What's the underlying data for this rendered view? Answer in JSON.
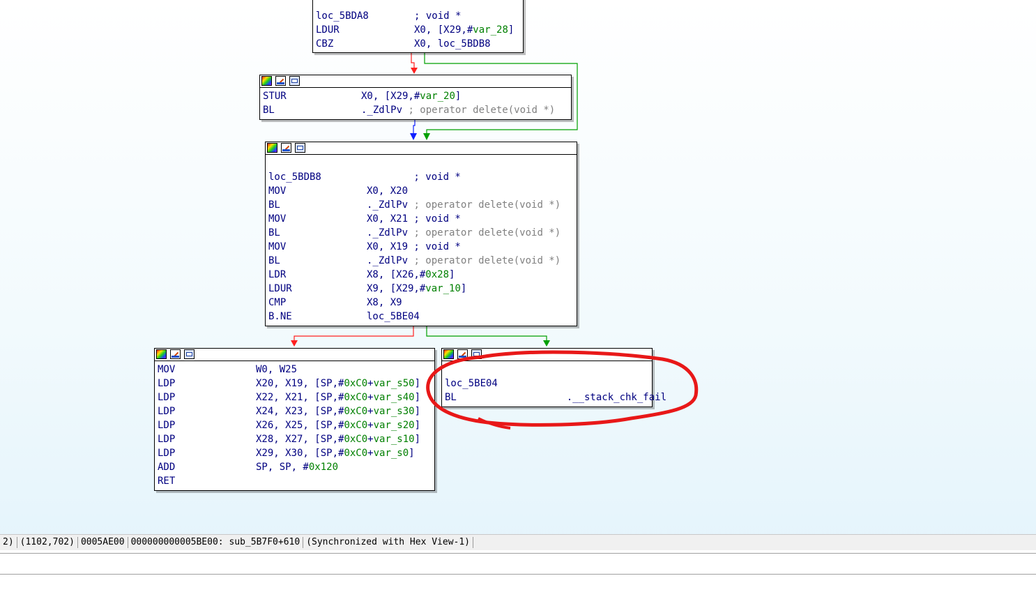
{
  "blocks": {
    "b1": {
      "rows": [
        {
          "mn": "loc_5BDA8",
          "ops": [
            {
              "t": "; void *",
              "c": "lbl"
            }
          ]
        },
        {
          "mn": "LDUR",
          "ops": [
            {
              "t": "X0, [X29,#",
              "c": "lbl"
            },
            {
              "t": "var_28",
              "c": "num"
            },
            {
              "t": "]",
              "c": "lbl"
            }
          ]
        },
        {
          "mn": "CBZ",
          "ops": [
            {
              "t": "X0, loc_5BDB8",
              "c": "lbl"
            }
          ]
        }
      ]
    },
    "b2": {
      "rows": [
        {
          "mn": "STUR",
          "ops": [
            {
              "t": "X0, [X29,#",
              "c": "lbl"
            },
            {
              "t": "var_20",
              "c": "num"
            },
            {
              "t": "]",
              "c": "lbl"
            }
          ]
        },
        {
          "mn": "BL",
          "ops": [
            {
              "t": "._ZdlPv ",
              "c": "lbl"
            },
            {
              "t": "; operator delete(void *)",
              "c": "cmt"
            }
          ]
        }
      ]
    },
    "b3": {
      "rows": [
        {
          "mn": "",
          "ops": []
        },
        {
          "mn": "loc_5BDB8",
          "ops": [
            {
              "t": "        ; void *",
              "c": "lbl"
            }
          ]
        },
        {
          "mn": "MOV",
          "ops": [
            {
              "t": "X0, X20",
              "c": "lbl"
            }
          ]
        },
        {
          "mn": "BL",
          "ops": [
            {
              "t": "._ZdlPv ",
              "c": "lbl"
            },
            {
              "t": "; operator delete(void *)",
              "c": "cmt"
            }
          ]
        },
        {
          "mn": "MOV",
          "ops": [
            {
              "t": "X0, X21 ; void *",
              "c": "lbl"
            }
          ]
        },
        {
          "mn": "BL",
          "ops": [
            {
              "t": "._ZdlPv ",
              "c": "lbl"
            },
            {
              "t": "; operator delete(void *)",
              "c": "cmt"
            }
          ]
        },
        {
          "mn": "MOV",
          "ops": [
            {
              "t": "X0, X19 ; void *",
              "c": "lbl"
            }
          ]
        },
        {
          "mn": "BL",
          "ops": [
            {
              "t": "._ZdlPv ",
              "c": "lbl"
            },
            {
              "t": "; operator delete(void *)",
              "c": "cmt"
            }
          ]
        },
        {
          "mn": "LDR",
          "ops": [
            {
              "t": "X8, [X26,#",
              "c": "lbl"
            },
            {
              "t": "0x28",
              "c": "num"
            },
            {
              "t": "]",
              "c": "lbl"
            }
          ]
        },
        {
          "mn": "LDUR",
          "ops": [
            {
              "t": "X9, [X29,#",
              "c": "lbl"
            },
            {
              "t": "var_10",
              "c": "num"
            },
            {
              "t": "]",
              "c": "lbl"
            }
          ]
        },
        {
          "mn": "CMP",
          "ops": [
            {
              "t": "X8, X9",
              "c": "lbl"
            }
          ]
        },
        {
          "mn": "B.NE",
          "ops": [
            {
              "t": "loc_5BE04",
              "c": "lbl"
            }
          ]
        }
      ]
    },
    "b4": {
      "rows": [
        {
          "mn": "MOV",
          "ops": [
            {
              "t": "W0, W25",
              "c": "lbl"
            }
          ]
        },
        {
          "mn": "LDP",
          "ops": [
            {
              "t": "X20, X19, [SP,#",
              "c": "lbl"
            },
            {
              "t": "0xC0",
              "c": "num"
            },
            {
              "t": "+",
              "c": "lbl"
            },
            {
              "t": "var_s50",
              "c": "num"
            },
            {
              "t": "]",
              "c": "lbl"
            }
          ]
        },
        {
          "mn": "LDP",
          "ops": [
            {
              "t": "X22, X21, [SP,#",
              "c": "lbl"
            },
            {
              "t": "0xC0",
              "c": "num"
            },
            {
              "t": "+",
              "c": "lbl"
            },
            {
              "t": "var_s40",
              "c": "num"
            },
            {
              "t": "]",
              "c": "lbl"
            }
          ]
        },
        {
          "mn": "LDP",
          "ops": [
            {
              "t": "X24, X23, [SP,#",
              "c": "lbl"
            },
            {
              "t": "0xC0",
              "c": "num"
            },
            {
              "t": "+",
              "c": "lbl"
            },
            {
              "t": "var_s30",
              "c": "num"
            },
            {
              "t": "]",
              "c": "lbl"
            }
          ]
        },
        {
          "mn": "LDP",
          "ops": [
            {
              "t": "X26, X25, [SP,#",
              "c": "lbl"
            },
            {
              "t": "0xC0",
              "c": "num"
            },
            {
              "t": "+",
              "c": "lbl"
            },
            {
              "t": "var_s20",
              "c": "num"
            },
            {
              "t": "]",
              "c": "lbl"
            }
          ]
        },
        {
          "mn": "LDP",
          "ops": [
            {
              "t": "X28, X27, [SP,#",
              "c": "lbl"
            },
            {
              "t": "0xC0",
              "c": "num"
            },
            {
              "t": "+",
              "c": "lbl"
            },
            {
              "t": "var_s10",
              "c": "num"
            },
            {
              "t": "]",
              "c": "lbl"
            }
          ]
        },
        {
          "mn": "LDP",
          "ops": [
            {
              "t": "X29, X30, [SP,#",
              "c": "lbl"
            },
            {
              "t": "0xC0",
              "c": "num"
            },
            {
              "t": "+",
              "c": "lbl"
            },
            {
              "t": "var_s0",
              "c": "num"
            },
            {
              "t": "]",
              "c": "lbl"
            }
          ]
        },
        {
          "mn": "ADD",
          "ops": [
            {
              "t": "SP, SP, #",
              "c": "lbl"
            },
            {
              "t": "0x120",
              "c": "num"
            }
          ]
        },
        {
          "mn": "RET",
          "ops": []
        }
      ]
    },
    "b5": {
      "rows": [
        {
          "mn": "",
          "ops": []
        },
        {
          "mn": "loc_5BE04",
          "ops": []
        },
        {
          "mn": "BL",
          "ops": [
            {
              "t": "    .__stack_chk_fail",
              "c": "lbl"
            }
          ]
        }
      ]
    }
  },
  "header_icons": [
    "color-palette-icon",
    "edit-pencil-icon",
    "graph-overview-icon"
  ],
  "status": {
    "fields": [
      "2)",
      "(1102,702)",
      "0005AE00",
      "000000000005BE00: sub_5B7F0+610",
      "(Synchronized with Hex View-1)"
    ]
  },
  "colors": {
    "edge_false": "#ff2020",
    "edge_true": "#00a000",
    "edge_flow": "#1020ff",
    "annotation": "#e81818",
    "text": "#000080",
    "number": "#008000",
    "comment": "#808080"
  }
}
